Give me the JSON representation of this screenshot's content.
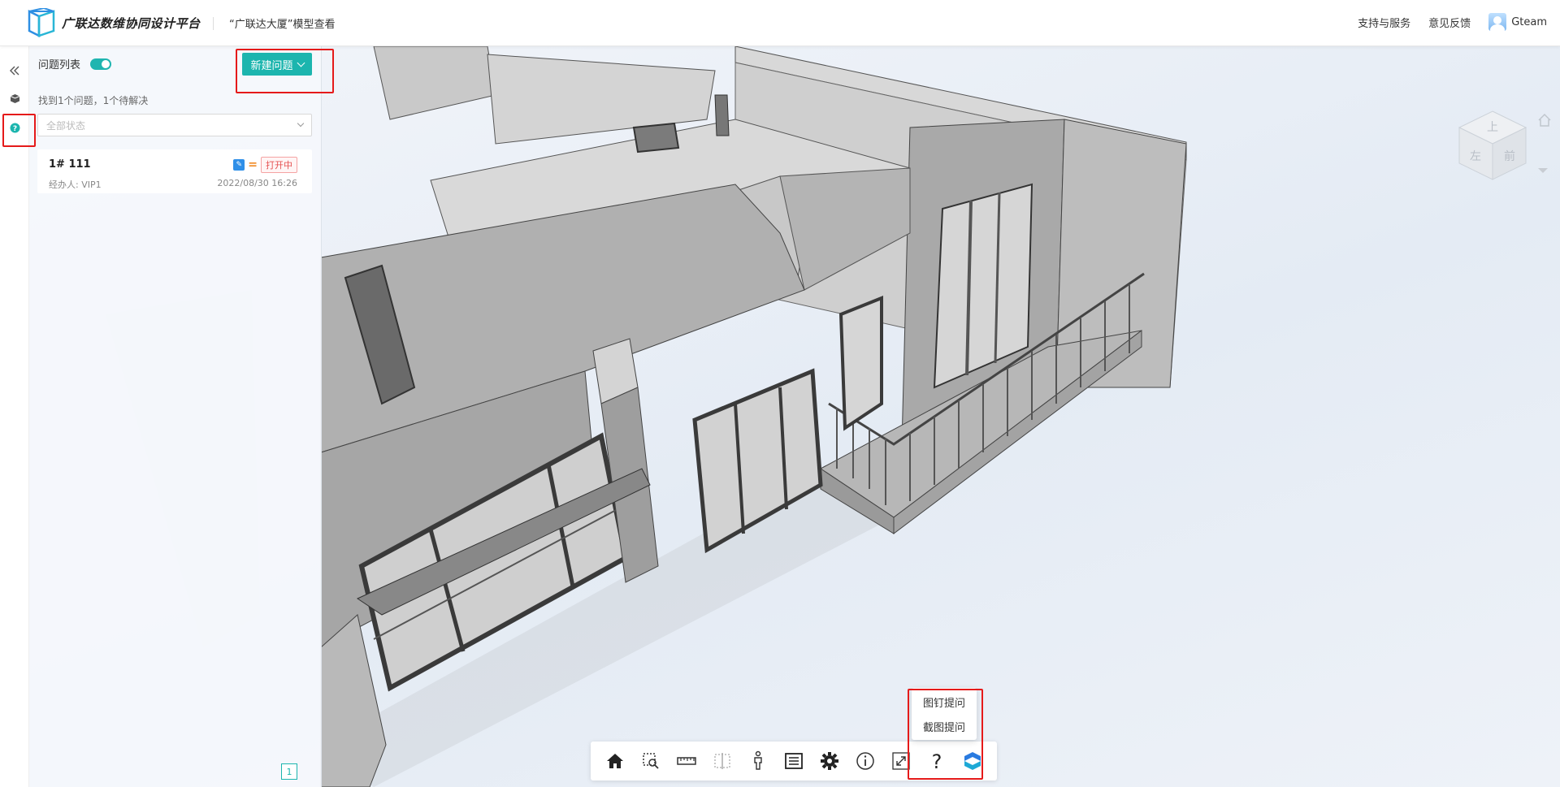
{
  "header": {
    "brand": "广联达数维协同设计平台",
    "project": "“广联达大厦”模型查看",
    "support": "支持与服务",
    "feedback": "意见反馈",
    "username": "Gteam"
  },
  "sidebar": {
    "collapse_icon": "double-chevron-left-icon",
    "items": [
      {
        "icon": "model-cube-icon",
        "active": false
      },
      {
        "icon": "question-circle-icon",
        "active": true
      }
    ]
  },
  "issues_panel": {
    "title": "问题列表",
    "toggle_on": true,
    "new_button": "新建问题",
    "summary": "找到1个问题，1个待解决",
    "status_filter": {
      "placeholder": "全部状态"
    },
    "issues": [
      {
        "title": "1# 111",
        "assignee": "经办人: VIP1",
        "date": "2022/08/30 16:26",
        "status": "打开中"
      }
    ],
    "page": "1"
  },
  "viewcube": {
    "faces": [
      "上",
      "左",
      "前"
    ]
  },
  "toolbar": {
    "items": [
      "home-icon",
      "zoom-box-icon",
      "measure-ruler-icon",
      "section-box-icon",
      "person-walk-icon",
      "property-list-icon",
      "settings-gear-icon",
      "info-icon",
      "fullscreen-icon",
      "question-icon",
      "brand-logo-icon"
    ]
  },
  "issue_popup": {
    "items": [
      "图钉提问",
      "截图提问"
    ]
  },
  "colors": {
    "accent": "#1cb5ae",
    "highlight": "#e51a1a",
    "status_open": "#e55050"
  }
}
